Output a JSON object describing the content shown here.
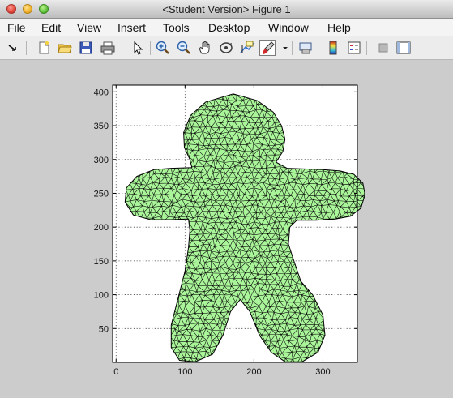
{
  "window": {
    "title": "<Student Version> Figure 1",
    "close_icon": "close-icon",
    "minimize_icon": "minimize-icon",
    "maximize_icon": "maximize-icon"
  },
  "menu": [
    "File",
    "Edit",
    "View",
    "Insert",
    "Tools",
    "Desktop",
    "Window",
    "Help"
  ],
  "toolbar": {
    "icons": [
      "dock-arrow-icon",
      "new-figure-icon",
      "open-file-icon",
      "save-icon",
      "print-icon",
      "pointer-icon",
      "zoom-in-icon",
      "zoom-out-icon",
      "pan-hand-icon",
      "rotate-3d-icon",
      "data-cursor-icon",
      "brush-icon",
      "brush-dropdown-icon",
      "link-plot-icon",
      "colorbar-icon",
      "legend-icon",
      "hide-plot-tools-icon",
      "show-plot-tools-icon"
    ]
  },
  "colors": {
    "mesh_fill": "#aaf59a",
    "mesh_edge": "#000000",
    "axes_bg": "#ffffff",
    "figure_bg": "#cccccc"
  },
  "chart_data": {
    "type": "mesh",
    "title": "",
    "xlabel": "",
    "ylabel": "",
    "xlim": [
      -5,
      350
    ],
    "ylim": [
      0,
      410
    ],
    "xticks": [
      0,
      100,
      200,
      300
    ],
    "yticks": [
      50,
      100,
      150,
      200,
      250,
      300,
      350,
      400
    ],
    "grid": true,
    "box": true,
    "description_shape": "gingerbread-man",
    "outline": [
      [
        170,
        397
      ],
      [
        205,
        387
      ],
      [
        228,
        370
      ],
      [
        240,
        350
      ],
      [
        245,
        330
      ],
      [
        242,
        312
      ],
      [
        232,
        296
      ],
      [
        248,
        287
      ],
      [
        300,
        285
      ],
      [
        325,
        283
      ],
      [
        345,
        278
      ],
      [
        358,
        265
      ],
      [
        361,
        248
      ],
      [
        355,
        228
      ],
      [
        340,
        216
      ],
      [
        318,
        212
      ],
      [
        290,
        210
      ],
      [
        262,
        210
      ],
      [
        252,
        200
      ],
      [
        250,
        175
      ],
      [
        258,
        150
      ],
      [
        268,
        120
      ],
      [
        285,
        100
      ],
      [
        300,
        70
      ],
      [
        303,
        40
      ],
      [
        293,
        15
      ],
      [
        270,
        1
      ],
      [
        245,
        1
      ],
      [
        225,
        15
      ],
      [
        208,
        40
      ],
      [
        194,
        75
      ],
      [
        180,
        93
      ],
      [
        166,
        75
      ],
      [
        155,
        40
      ],
      [
        140,
        12
      ],
      [
        115,
        1
      ],
      [
        92,
        3
      ],
      [
        80,
        22
      ],
      [
        80,
        55
      ],
      [
        90,
        95
      ],
      [
        100,
        135
      ],
      [
        105,
        170
      ],
      [
        107,
        195
      ],
      [
        105,
        212
      ],
      [
        80,
        211
      ],
      [
        50,
        211
      ],
      [
        25,
        218
      ],
      [
        13,
        237
      ],
      [
        15,
        258
      ],
      [
        30,
        275
      ],
      [
        55,
        285
      ],
      [
        80,
        287
      ],
      [
        110,
        288
      ],
      [
        107,
        300
      ],
      [
        99,
        318
      ],
      [
        98,
        340
      ],
      [
        108,
        365
      ],
      [
        130,
        385
      ]
    ]
  }
}
